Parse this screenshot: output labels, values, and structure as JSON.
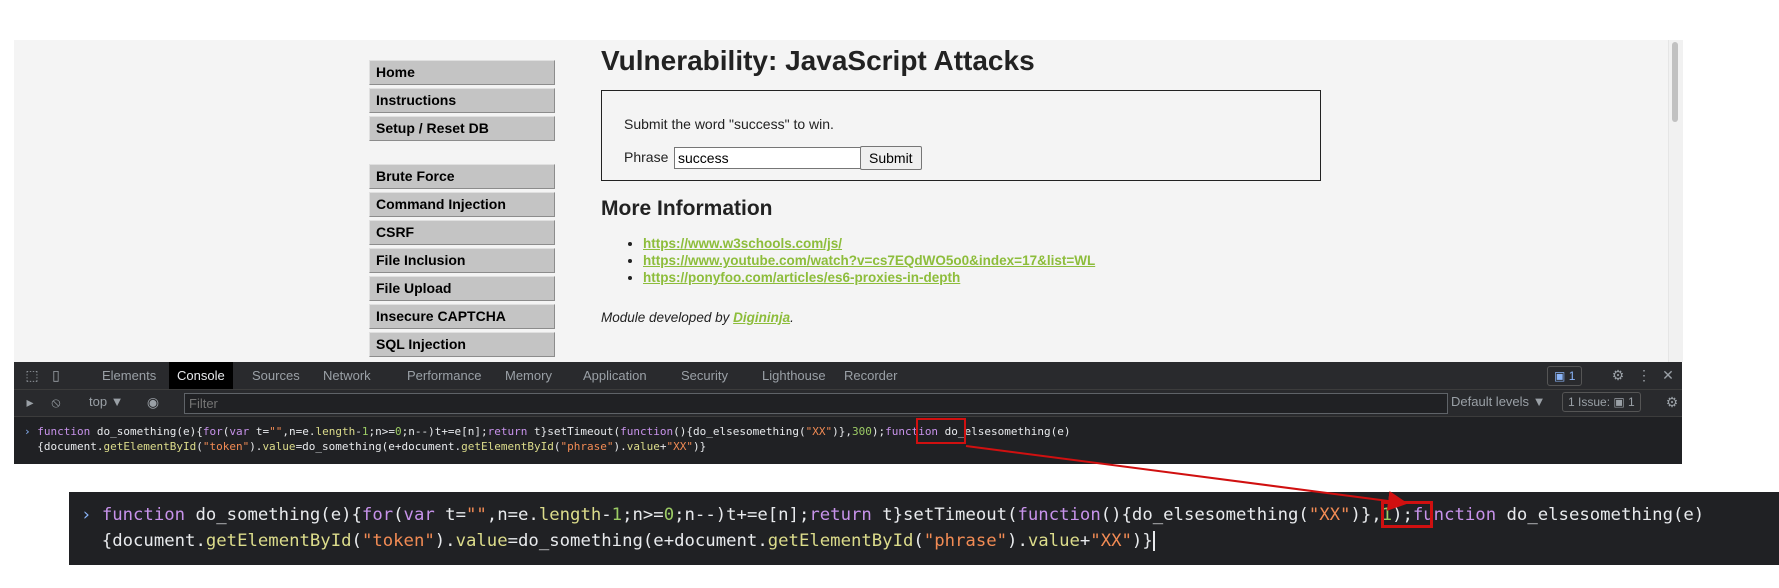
{
  "menu": {
    "group1": [
      "Home",
      "Instructions",
      "Setup / Reset DB"
    ],
    "group2": [
      "Brute Force",
      "Command Injection",
      "CSRF",
      "File Inclusion",
      "File Upload",
      "Insecure CAPTCHA",
      "SQL Injection"
    ]
  },
  "main": {
    "title": "Vulnerability: JavaScript Attacks",
    "instructions": "Submit the word \"success\" to win.",
    "phrase_label": "Phrase",
    "phrase_value": "success",
    "submit_label": "Submit",
    "more_info_title": "More Information",
    "links": [
      "https://www.w3schools.com/js/",
      "https://www.youtube.com/watch?v=cs7EQdWO5o0&index=17&list=WL",
      "https://ponyfoo.com/articles/es6-proxies-in-depth"
    ],
    "module_prefix": "Module developed by ",
    "module_author": "Digininja",
    "module_suffix": "."
  },
  "devtools": {
    "tabs": [
      "Elements",
      "Console",
      "Sources",
      "Network",
      "Performance",
      "Memory",
      "Application",
      "Security",
      "Lighthouse",
      "Recorder"
    ],
    "active_tab": "Console",
    "issue_badge": "1",
    "context": "top ▼",
    "filter_placeholder": "Filter",
    "levels": "Default levels ▼",
    "issues": "1 Issue: ▣ 1"
  },
  "code": {
    "delay_original": "300",
    "delay_modified": "1"
  },
  "colors": {
    "highlight": "#d01010",
    "link": "#8dbd3b",
    "devtools_bg": "#202124"
  }
}
